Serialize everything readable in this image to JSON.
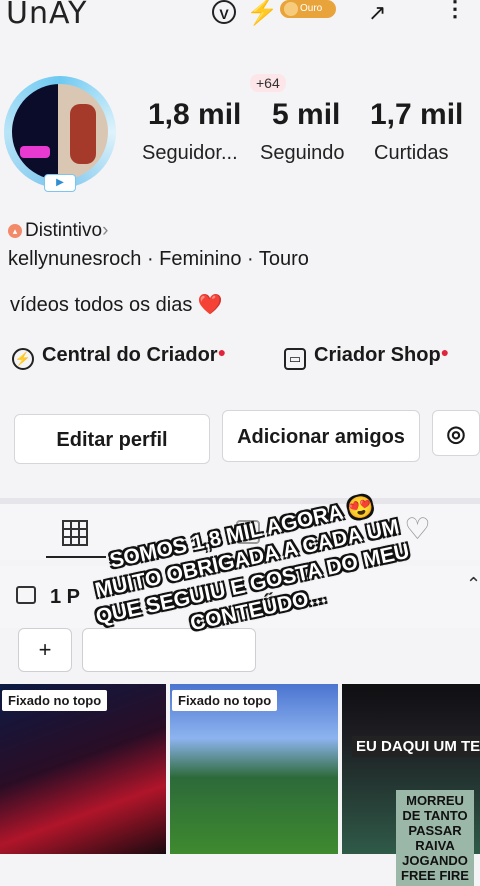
{
  "header": {
    "logo_text": "UnAY",
    "verified_letter": "V",
    "bolt_glyph": "⚡",
    "ouro_label": "Ouro",
    "share_glyph": "↗",
    "more_glyph": "⋮"
  },
  "avatar": {
    "tag": "▶"
  },
  "stats": {
    "badge": "+64",
    "items": [
      {
        "value": "1,8 mil",
        "label": "Seguidor..."
      },
      {
        "value": "5 mil",
        "label": "Seguindo"
      },
      {
        "value": "1,7 mil",
        "label": "Curtidas"
      }
    ]
  },
  "profile": {
    "distintivo": "Distintivo",
    "distintivo_chevron": "›",
    "info_line": "kellynunesroch · Feminino · Touro",
    "bio": "vídeos todos os dias",
    "bio_emoji": "❤️"
  },
  "creator_links": [
    {
      "label": "Central do Criador",
      "icon": "⚡"
    },
    {
      "label": "Criador Shop",
      "icon": "▭"
    }
  ],
  "buttons": {
    "edit": "Editar perfil",
    "add_friends": "Adicionar amigos",
    "instagram_icon": "◎"
  },
  "playlist": {
    "label": "1 P",
    "add_glyph": "+",
    "chevron": "⌃"
  },
  "overlay_text": {
    "line1": "SOMOS 1,8 MIL AGORA 😍",
    "line2": "MUITO OBRIGADA A CADA UM",
    "line3": "QUE SEGUIU E GOSTA DO MEU",
    "line4": "CONTEÚDO..."
  },
  "videos": [
    {
      "pin": "Fixado no topo"
    },
    {
      "pin": "Fixado no topo"
    },
    {
      "text1": "EU DAQUI UM TEM",
      "text2": "MORREU DE TANTO PASSAR RAIVA JOGANDO FREE FIRE"
    }
  ],
  "colors": {
    "accent_red": "#e0243c",
    "ouro": "#e8a43a",
    "ring": "#6ec9f2"
  }
}
